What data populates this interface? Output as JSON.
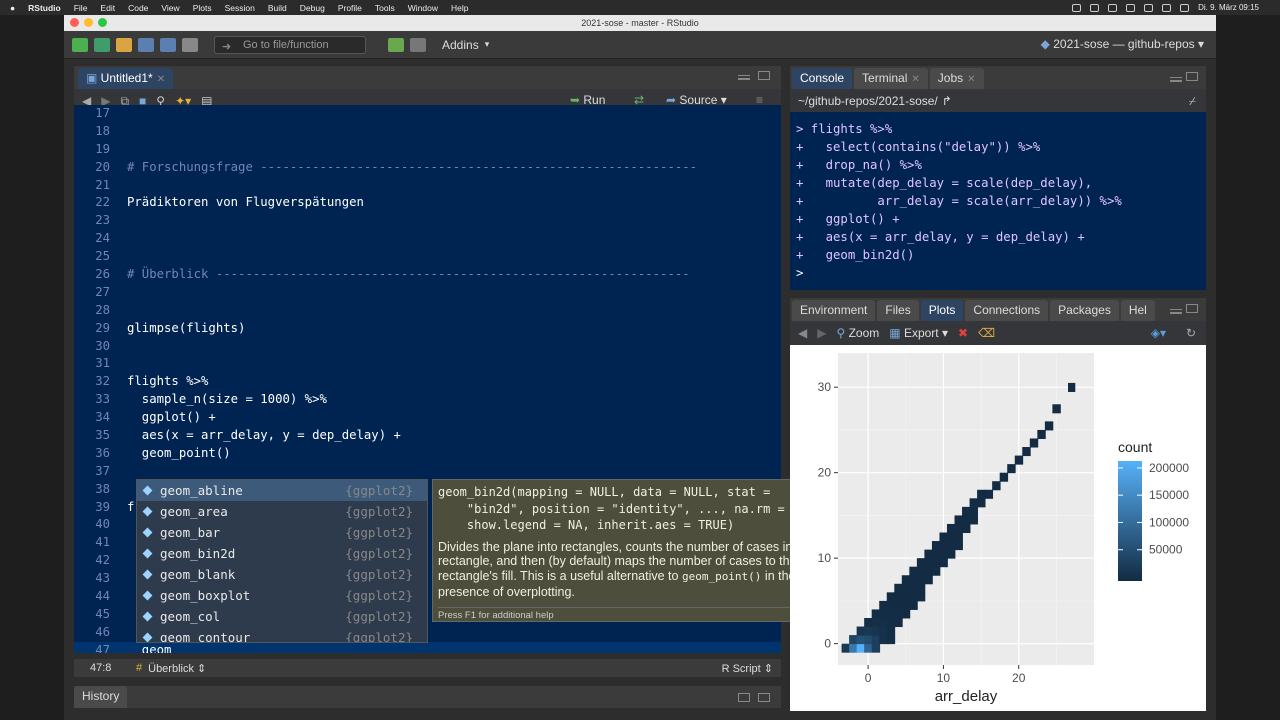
{
  "menubar": {
    "apple": "",
    "app": "RStudio",
    "items": [
      "File",
      "Edit",
      "Code",
      "View",
      "Plots",
      "Session",
      "Build",
      "Debug",
      "Profile",
      "Tools",
      "Window",
      "Help"
    ],
    "datetime": "Di. 9. März  09:15"
  },
  "window": {
    "title": "2021-sose - master - RStudio"
  },
  "toolbar": {
    "goto_placeholder": "Go to file/function",
    "addins_label": "Addins",
    "project_label": "2021-sose — github-repos"
  },
  "source_pane": {
    "tab_label": "Untitled1*",
    "run_label": "Run",
    "source_label": "Source",
    "lines": [
      {
        "n": "17",
        "t": ""
      },
      {
        "n": "18",
        "t": ""
      },
      {
        "n": "19",
        "t": ""
      },
      {
        "n": "20",
        "t": "# Forschungsfrage -----------------------------------------------------------"
      },
      {
        "n": "21",
        "t": ""
      },
      {
        "n": "22",
        "t": "Prädiktoren von Flugverspätungen"
      },
      {
        "n": "23",
        "t": ""
      },
      {
        "n": "24",
        "t": ""
      },
      {
        "n": "25",
        "t": ""
      },
      {
        "n": "26",
        "t": "# Überblick ----------------------------------------------------------------"
      },
      {
        "n": "27",
        "t": ""
      },
      {
        "n": "28",
        "t": ""
      },
      {
        "n": "29",
        "t": "glimpse(flights)"
      },
      {
        "n": "30",
        "t": ""
      },
      {
        "n": "31",
        "t": ""
      },
      {
        "n": "32",
        "t": "flights %>%"
      },
      {
        "n": "33",
        "t": "  sample_n(size = 1000) %>%"
      },
      {
        "n": "34",
        "t": "  ggplot() +"
      },
      {
        "n": "35",
        "t": "  aes(x = arr_delay, y = dep_delay) +"
      },
      {
        "n": "36",
        "t": "  geom_point()"
      },
      {
        "n": "37",
        "t": ""
      },
      {
        "n": "38",
        "t": ""
      },
      {
        "n": "39",
        "t": "f"
      },
      {
        "n": "40",
        "t": ""
      },
      {
        "n": "41",
        "t": ""
      },
      {
        "n": "42",
        "t": ""
      },
      {
        "n": "43",
        "t": ""
      },
      {
        "n": "44",
        "t": ""
      },
      {
        "n": "45",
        "t": ""
      },
      {
        "n": "46",
        "t": ""
      },
      {
        "n": "47",
        "t": "  geom_"
      }
    ],
    "status_pos": "47:8",
    "status_section": "Überblick",
    "status_type": "R Script"
  },
  "completion": {
    "items": [
      {
        "name": "geom_abline",
        "pkg": "{ggplot2}"
      },
      {
        "name": "geom_area",
        "pkg": "{ggplot2}"
      },
      {
        "name": "geom_bar",
        "pkg": "{ggplot2}"
      },
      {
        "name": "geom_bin2d",
        "pkg": "{ggplot2}"
      },
      {
        "name": "geom_blank",
        "pkg": "{ggplot2}"
      },
      {
        "name": "geom_boxplot",
        "pkg": "{ggplot2}"
      },
      {
        "name": "geom_col",
        "pkg": "{ggplot2}"
      },
      {
        "name": "geom_contour",
        "pkg": "{ggplot2}"
      }
    ],
    "help_signature": "geom_bin2d(mapping = NULL, data = NULL, stat =\n    \"bin2d\", position = \"identity\", ..., na.rm = FALSE,\n    show.legend = NA, inherit.aes = TRUE)",
    "help_description_1": "Divides the plane into rectangles, counts the number of cases in each rectangle, and then (by default) maps the number of cases to the rectangle's fill. This is a useful alternative to ",
    "help_description_code": "geom_point()",
    "help_description_2": " in the presence of overplotting.",
    "help_footer": "Press F1 for additional help"
  },
  "console_pane": {
    "tabs": [
      "Console",
      "Terminal",
      "Jobs"
    ],
    "path": "~/github-repos/2021-sose/",
    "lines": [
      "> flights %>%",
      "+   select(contains(\"delay\")) %>%",
      "+   drop_na() %>%",
      "+   mutate(dep_delay = scale(dep_delay),",
      "+          arr_delay = scale(arr_delay)) %>%",
      "+   ggplot() +",
      "+   aes(x = arr_delay, y = dep_delay) +",
      "+   geom_bin2d()",
      "> "
    ]
  },
  "plots_pane": {
    "tabs": [
      "Environment",
      "Files",
      "Plots",
      "Connections",
      "Packages",
      "Hel"
    ],
    "zoom_label": "Zoom",
    "export_label": "Export"
  },
  "history_pane": {
    "label": "History"
  },
  "chart_data": {
    "type": "heatmap",
    "xlabel": "arr_delay",
    "ylabel": "",
    "x_ticks": [
      0,
      10,
      20
    ],
    "y_ticks": [
      0,
      10,
      20,
      30
    ],
    "xlim": [
      -4,
      30
    ],
    "ylim": [
      -2.5,
      34
    ],
    "legend_title": "count",
    "legend_ticks": [
      50000,
      100000,
      150000,
      200000
    ],
    "legend_placement": "right",
    "colors": {
      "low": "#132b43",
      "high": "#56b1f7",
      "panel": "#ebebeb"
    },
    "bins": [
      [
        -3,
        -0.5,
        20000
      ],
      [
        -2,
        -0.5,
        120000
      ],
      [
        -1,
        -0.5,
        210000
      ],
      [
        0,
        -0.5,
        90000
      ],
      [
        1,
        -0.5,
        30000
      ],
      [
        -2,
        0.5,
        40000
      ],
      [
        -1,
        0.5,
        60000
      ],
      [
        0,
        0.5,
        50000
      ],
      [
        1,
        0.5,
        30000
      ],
      [
        2,
        0.5,
        10000
      ],
      [
        3,
        0.5,
        5000
      ],
      [
        -1,
        1.5,
        15000
      ],
      [
        0,
        1.5,
        20000
      ],
      [
        1,
        1.5,
        15000
      ],
      [
        2,
        1.5,
        10000
      ],
      [
        3,
        1.5,
        5000
      ],
      [
        0,
        2.5,
        5000
      ],
      [
        1,
        2.5,
        8000
      ],
      [
        2,
        2.5,
        6000
      ],
      [
        3,
        2.5,
        4000
      ],
      [
        4,
        2.5,
        2000
      ],
      [
        1,
        3.5,
        3000
      ],
      [
        2,
        3.5,
        3000
      ],
      [
        3,
        3.5,
        3000
      ],
      [
        4,
        3.5,
        2000
      ],
      [
        5,
        3.5,
        1000
      ],
      [
        2,
        4.5,
        1500
      ],
      [
        3,
        4.5,
        1500
      ],
      [
        4,
        4.5,
        1500
      ],
      [
        5,
        4.5,
        1000
      ],
      [
        6,
        4.5,
        500
      ],
      [
        3,
        5.5,
        800
      ],
      [
        4,
        5.5,
        800
      ],
      [
        5,
        5.5,
        800
      ],
      [
        6,
        5.5,
        500
      ],
      [
        7,
        5.5,
        300
      ],
      [
        4,
        6.5,
        500
      ],
      [
        5,
        6.5,
        500
      ],
      [
        6,
        6.5,
        400
      ],
      [
        7,
        6.5,
        300
      ],
      [
        5,
        7.5,
        300
      ],
      [
        6,
        7.5,
        300
      ],
      [
        7,
        7.5,
        200
      ],
      [
        8,
        7.5,
        150
      ],
      [
        6,
        8.5,
        200
      ],
      [
        7,
        8.5,
        200
      ],
      [
        8,
        8.5,
        150
      ],
      [
        9,
        8.5,
        100
      ],
      [
        7,
        9.5,
        150
      ],
      [
        8,
        9.5,
        120
      ],
      [
        9,
        9.5,
        100
      ],
      [
        10,
        9.5,
        80
      ],
      [
        8,
        10.5,
        100
      ],
      [
        9,
        10.5,
        80
      ],
      [
        10,
        10.5,
        60
      ],
      [
        11,
        10.5,
        50
      ],
      [
        9,
        11.5,
        60
      ],
      [
        10,
        11.5,
        50
      ],
      [
        11,
        11.5,
        40
      ],
      [
        12,
        11.5,
        30
      ],
      [
        10,
        12.5,
        40
      ],
      [
        11,
        12.5,
        30
      ],
      [
        12,
        12.5,
        25
      ],
      [
        11,
        13.5,
        25
      ],
      [
        12,
        13.5,
        20
      ],
      [
        13,
        13.5,
        15
      ],
      [
        12,
        14.5,
        15
      ],
      [
        13,
        14.5,
        12
      ],
      [
        14,
        14.5,
        10
      ],
      [
        13,
        15.5,
        10
      ],
      [
        14,
        15.5,
        8
      ],
      [
        14,
        16.5,
        8
      ],
      [
        15,
        16.5,
        6
      ],
      [
        15,
        17.5,
        5
      ],
      [
        16,
        17.5,
        5
      ],
      [
        17,
        18.5,
        4
      ],
      [
        18,
        19.5,
        3
      ],
      [
        19,
        20.5,
        3
      ],
      [
        20,
        21.5,
        2
      ],
      [
        21,
        22.5,
        2
      ],
      [
        22,
        23.5,
        2
      ],
      [
        23,
        24.5,
        1
      ],
      [
        24,
        25.5,
        1
      ],
      [
        25,
        27.5,
        1
      ],
      [
        27,
        30,
        1
      ]
    ]
  }
}
